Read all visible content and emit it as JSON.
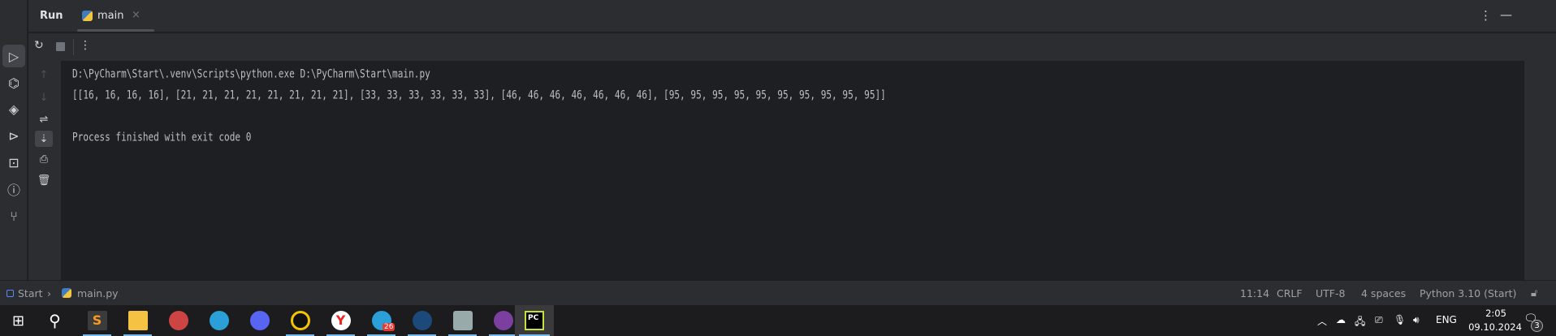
{
  "tool_window": {
    "title": "Run",
    "tab": {
      "label": "main",
      "close": "×"
    }
  },
  "console": {
    "lines": [
      "D:\\PyCharm\\Start\\.venv\\Scripts\\python.exe D:\\PyCharm\\Start\\main.py",
      "[[16, 16, 16, 16], [21, 21, 21, 21, 21, 21, 21, 21], [33, 33, 33, 33, 33, 33], [46, 46, 46, 46, 46, 46, 46], [95, 95, 95, 95, 95, 95, 95, 95, 95, 95]]",
      "",
      "Process finished with exit code 0"
    ]
  },
  "breadcrumb": {
    "project": "Start",
    "sep": "›",
    "file": "main.py"
  },
  "status": {
    "position": "11:14",
    "line_sep": "CRLF",
    "encoding": "UTF-8",
    "indent": "4 spaces",
    "interpreter": "Python 3.10 (Start)"
  },
  "taskbar": {
    "apps": [
      "windows-start",
      "search",
      "sublime-text",
      "file-explorer",
      "snipping",
      "telegram",
      "discord",
      "music",
      "yandex-browser",
      "telegram-2",
      "steam",
      "monitor",
      "github-desktop",
      "pycharm"
    ],
    "telegram_badge": "26",
    "lang": "ENG",
    "time": "2:05",
    "date": "09.10.2024",
    "notifications": "3"
  },
  "colors": {
    "accent": "#3574f0",
    "taskbar_indicator": "#76b9ed",
    "run_green": "#5fb865"
  }
}
